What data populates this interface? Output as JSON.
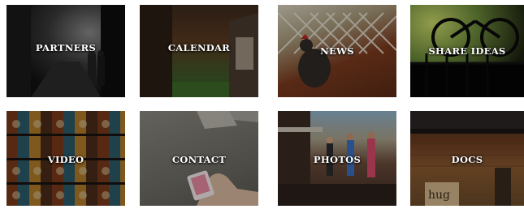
{
  "tiles": [
    {
      "label": "PARTNERS"
    },
    {
      "label": "CALENDAR"
    },
    {
      "label": "NEWS"
    },
    {
      "label": "SHARE IDEAS"
    },
    {
      "label": "VIDEO"
    },
    {
      "label": "CONTACT"
    },
    {
      "label": "PHOTOS"
    },
    {
      "label": "DOCS"
    }
  ],
  "decor": {
    "docs_sign_text": "hug"
  }
}
